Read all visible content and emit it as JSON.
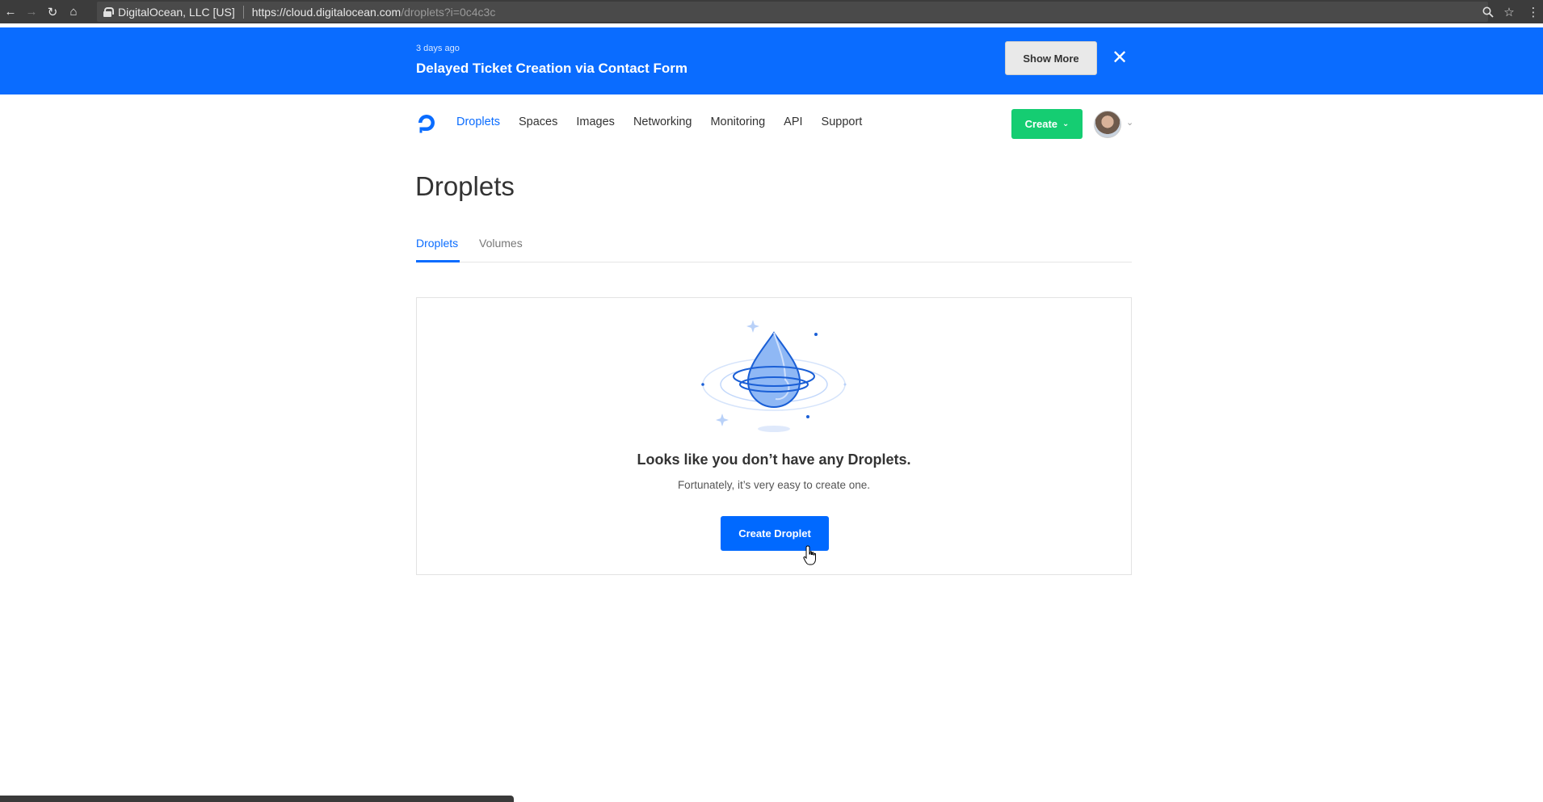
{
  "browser": {
    "org_label": "DigitalOcean, LLC [US]",
    "url_host": "https://cloud.digitalocean.com",
    "url_path": "/droplets?i=0c4c3c"
  },
  "banner": {
    "meta": "3 days ago",
    "title": "Delayed Ticket Creation via Contact Form",
    "show_more_label": "Show More",
    "close_symbol": "✕",
    "color": "#0a6cff"
  },
  "nav": {
    "items": [
      "Droplets",
      "Spaces",
      "Images",
      "Networking",
      "Monitoring",
      "API",
      "Support"
    ],
    "active": "Droplets",
    "create_label": "Create",
    "create_color": "#15cd72"
  },
  "page": {
    "title": "Droplets",
    "tabs": [
      "Droplets",
      "Volumes"
    ],
    "active_tab": "Droplets"
  },
  "empty_state": {
    "heading": "Looks like you don’t have any Droplets.",
    "subtext": "Fortunately, it’s very easy to create one.",
    "button_label": "Create Droplet",
    "button_color": "#0069ff"
  }
}
